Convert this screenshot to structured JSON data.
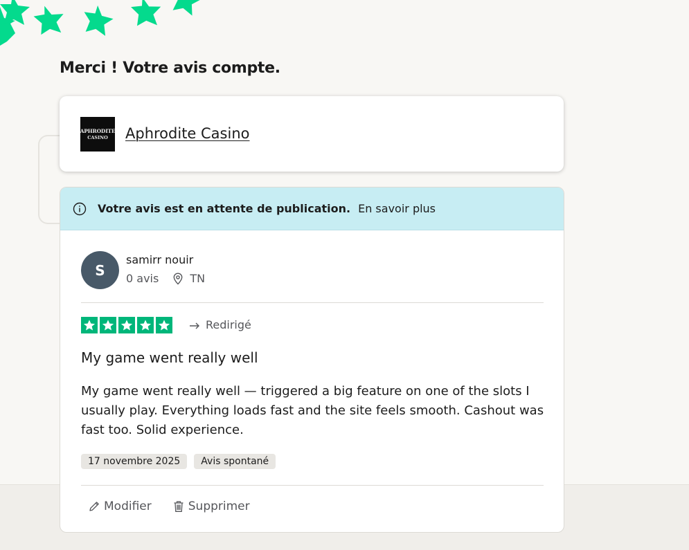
{
  "page": {
    "title": "Merci ! Votre avis compte."
  },
  "company": {
    "logo_text_line1": "APHRODITE",
    "logo_text_line2": "CASINO",
    "name": "Aphrodite Casino"
  },
  "notice": {
    "icon": "info-circle-icon",
    "text": "Votre avis est en attente de publication.",
    "link": "En savoir plus",
    "bg_color": "#c7edf3"
  },
  "reviewer": {
    "initial": "S",
    "name": "samirr nouir",
    "review_count": "0 avis",
    "country": "TN",
    "avatar_color": "#485968"
  },
  "review": {
    "rating": 5,
    "star_color": "#00b67a",
    "status": "Redirigé",
    "title": "My game went really well",
    "body": "My game went really well — triggered a big feature on one of the slots I usually play. Everything loads fast and the site feels smooth. Cashout was fast too. Solid experience.",
    "date": "17 novembre 2025",
    "type_badge": "Avis spontané"
  },
  "actions": {
    "edit_label": "Modifier",
    "delete_label": "Supprimer"
  },
  "decoration": {
    "star_color": "#04da8d"
  }
}
